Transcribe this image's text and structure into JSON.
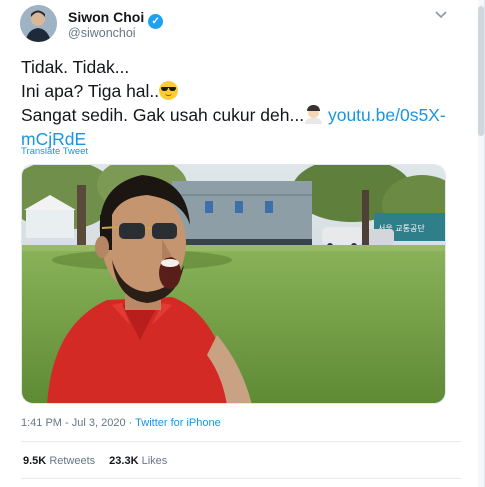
{
  "author": {
    "name": "Siwon Choi",
    "handle": "@siwonchoi",
    "verified": true
  },
  "tweet": {
    "line1": "Tidak. Tidak...",
    "line2": "Ini apa? Tiga hal..",
    "line3": "Sangat sedih. Gak usah cukur deh...",
    "link_part1": "youtu.be/0s5X-",
    "link_part2": "mCjRdE",
    "emoji_line2": "smiling-face-with-sunglasses",
    "emoji_line3": "man-emoji"
  },
  "translate_label": "Translate Tweet",
  "meta": {
    "time": "1:41 PM - Jul 3, 2020 · ",
    "app": "Twitter for iPhone"
  },
  "stats": {
    "retweets_count": "9.5K",
    "retweets_label": "Retweets",
    "likes_count": "23.3K",
    "likes_label": "Likes"
  },
  "photo_sign": "서울 교통공단"
}
